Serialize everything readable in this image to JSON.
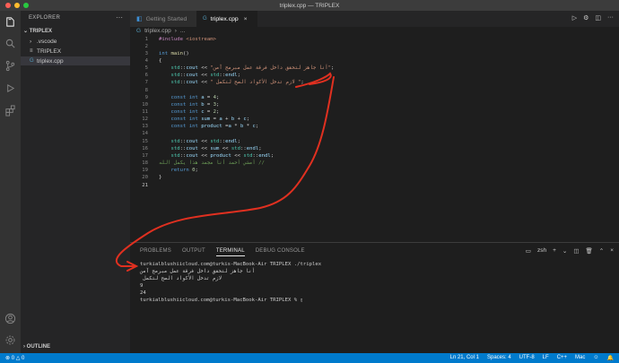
{
  "window": {
    "title": "triplex.cpp — TRIPLEX"
  },
  "sidebar": {
    "header": "EXPLORER",
    "menu_icon": "more-icon",
    "section": "TRIPLEX",
    "items": [
      {
        "label": ".vscode",
        "icon": "chevron-right-icon"
      },
      {
        "label": "TRIPLEX",
        "icon": "file-icon"
      },
      {
        "label": "triplex.cpp",
        "icon": "cpp-file-icon"
      }
    ],
    "outline": "OUTLINE"
  },
  "tabs": [
    {
      "label": "Getting Started"
    },
    {
      "label": "triplex.cpp"
    }
  ],
  "breadcrumb": {
    "file": "triplex.cpp",
    "symbol": "..."
  },
  "code": {
    "lines": [
      "#include <iostream>",
      "",
      "int main()",
      "{",
      "    std::cout << \"أنا جاهز لتحقق داخل فرقة عمل مبرمج آمن\";",
      "    std::cout << std::endl;",
      "    std::cout << \" لازم تدخل الأكواد الصح لتكمل \";",
      "",
      "    const int a = 4;",
      "    const int b = 3;",
      "    const int c = 2;",
      "    const int sum = a + b + c;",
      "    const int product =a * b * c;",
      "",
      "    std::cout << std::endl;",
      "    std::cout << sum << std::endl;",
      "    std::cout << product << std::endl;",
      "    // أمشي أحمد أنا مجمد هذا يكمل الله",
      "    return 0;",
      "}",
      ""
    ]
  },
  "panel": {
    "tabs": [
      "PROBLEMS",
      "OUTPUT",
      "TERMINAL",
      "DEBUG CONSOLE"
    ],
    "shell": "zsh",
    "terminal_lines": [
      "turkialblushiicloud.com@turkis-MacBook-Air TRIPLEX ./triplex",
      "أنا جاهز لتحقق داخل فرقة عمل مبرمج آمن",
      " لازم تدخل الأكواد الصح لتكمل",
      "9",
      "24",
      "turkialblushiicloud.com@turkis-MacBook-Air TRIPLEX % ▯"
    ]
  },
  "status": {
    "errors": "0",
    "warnings": "0",
    "position": "Ln 21, Col 1",
    "spaces": "Spaces: 4",
    "encoding": "UTF-8",
    "eol": "LF",
    "language": "C++",
    "platform": "Mac"
  },
  "colors": {
    "statusbar": "#007acc",
    "annotation": "#e03020"
  }
}
